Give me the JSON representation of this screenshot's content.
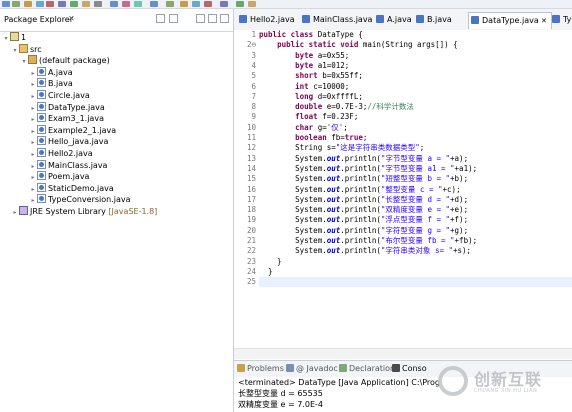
{
  "colors": {
    "keyword": "#7f0055",
    "string": "#2a00ff",
    "comment": "#3f7f5f",
    "field": "#0000c0",
    "line_number": "#787878",
    "jre_version": "#8a6a2a"
  },
  "explorer": {
    "title": "Package Explorer",
    "close": "✕",
    "tree": [
      {
        "label": "1",
        "indent": 0,
        "icon": "project-icon",
        "twisty": "▾"
      },
      {
        "label": "src",
        "indent": 1,
        "icon": "source-folder-icon",
        "twisty": "▾"
      },
      {
        "label": "(default package)",
        "indent": 2,
        "icon": "package-icon",
        "twisty": "▾"
      },
      {
        "label": "A.java",
        "indent": 3,
        "icon": "java-file-icon",
        "twisty": "▸"
      },
      {
        "label": "B.java",
        "indent": 3,
        "icon": "java-file-icon",
        "twisty": "▸"
      },
      {
        "label": "Circle.java",
        "indent": 3,
        "icon": "java-file-icon",
        "twisty": "▸"
      },
      {
        "label": "DataType.java",
        "indent": 3,
        "icon": "java-file-icon",
        "twisty": "▸"
      },
      {
        "label": "Exam3_1.java",
        "indent": 3,
        "icon": "java-file-icon",
        "twisty": "▸"
      },
      {
        "label": "Example2_1.java",
        "indent": 3,
        "icon": "java-file-icon",
        "twisty": "▸"
      },
      {
        "label": "Hello_java.java",
        "indent": 3,
        "icon": "java-file-icon",
        "twisty": "▸"
      },
      {
        "label": "Hello2.java",
        "indent": 3,
        "icon": "java-file-icon",
        "twisty": "▸"
      },
      {
        "label": "MainClass.java",
        "indent": 3,
        "icon": "java-file-icon",
        "twisty": "▸"
      },
      {
        "label": "Poem.java",
        "indent": 3,
        "icon": "java-file-icon",
        "twisty": "▸"
      },
      {
        "label": "StaticDemo.java",
        "indent": 3,
        "icon": "java-file-icon",
        "twisty": "▸"
      },
      {
        "label": "TypeConversion.java",
        "indent": 3,
        "icon": "java-file-icon",
        "twisty": "▸"
      },
      {
        "label": "JRE System Library",
        "indent": 1,
        "icon": "library-icon",
        "twisty": "▸",
        "suffix": "[JavaSE-1.8]"
      }
    ]
  },
  "editor_tabs": [
    {
      "label": "Hello2.java",
      "active": false
    },
    {
      "label": "MainClass.java",
      "active": false
    },
    {
      "label": "A.java",
      "active": false
    },
    {
      "label": "B.java",
      "active": false
    },
    {
      "label": "DataType.java",
      "active": true,
      "close": "✕"
    },
    {
      "label": "Ty",
      "active": false
    }
  ],
  "code_lines": [
    {
      "n": "1",
      "tokens": [
        [
          "kw",
          "public class "
        ],
        [
          "",
          "DataType {"
        ]
      ]
    },
    {
      "n": "2⊖",
      "tokens": [
        [
          "",
          "    "
        ],
        [
          "kw",
          "public static void "
        ],
        [
          "",
          "main(String args[]) {"
        ]
      ]
    },
    {
      "n": "3",
      "tokens": [
        [
          "",
          "        "
        ],
        [
          "kw",
          "byte "
        ],
        [
          "",
          "a=0x55;"
        ]
      ]
    },
    {
      "n": "4",
      "tokens": [
        [
          "",
          "        "
        ],
        [
          "kw",
          "byte "
        ],
        [
          "",
          "a1=012;"
        ]
      ]
    },
    {
      "n": "5",
      "tokens": [
        [
          "",
          "        "
        ],
        [
          "kw",
          "short "
        ],
        [
          "",
          "b=0x55ff;"
        ]
      ]
    },
    {
      "n": "6",
      "tokens": [
        [
          "",
          "        "
        ],
        [
          "kw",
          "int "
        ],
        [
          "",
          "c=10000;"
        ]
      ]
    },
    {
      "n": "7",
      "tokens": [
        [
          "",
          "        "
        ],
        [
          "kw",
          "long "
        ],
        [
          "",
          "d=0xffffL;"
        ]
      ]
    },
    {
      "n": "8",
      "tokens": [
        [
          "",
          "        "
        ],
        [
          "kw",
          "double "
        ],
        [
          "",
          "e=0.7E-3;"
        ],
        [
          "cmt",
          "//科学计数法"
        ]
      ]
    },
    {
      "n": "9",
      "tokens": [
        [
          "",
          "        "
        ],
        [
          "kw",
          "float "
        ],
        [
          "",
          "f=0.23F;"
        ]
      ]
    },
    {
      "n": "10",
      "tokens": [
        [
          "",
          "        "
        ],
        [
          "kw",
          "char "
        ],
        [
          "",
          "g="
        ],
        [
          "str",
          "'仅'"
        ],
        [
          ";",
          ";"
        ]
      ]
    },
    {
      "n": "11",
      "tokens": [
        [
          "",
          "        "
        ],
        [
          "kw",
          "boolean "
        ],
        [
          "",
          "fb="
        ],
        [
          "kw",
          "true"
        ],
        [
          "",
          ";"
        ]
      ]
    },
    {
      "n": "12",
      "tokens": [
        [
          "",
          "        String s="
        ],
        [
          "str",
          "\"这是字符串类数据类型\""
        ],
        [
          "",
          ";"
        ]
      ]
    },
    {
      "n": "13",
      "tokens": [
        [
          "",
          "        System."
        ],
        [
          "fld",
          "out"
        ],
        [
          "",
          ".println("
        ],
        [
          "str",
          "\"字节型变量 a = \""
        ],
        [
          "",
          "+a);"
        ]
      ]
    },
    {
      "n": "14",
      "tokens": [
        [
          "",
          "        System."
        ],
        [
          "fld",
          "out"
        ],
        [
          "",
          ".println("
        ],
        [
          "str",
          "\"字节型变量 a1 = \""
        ],
        [
          "",
          "+a1);"
        ]
      ]
    },
    {
      "n": "15",
      "tokens": [
        [
          "",
          "        System."
        ],
        [
          "fld",
          "out"
        ],
        [
          "",
          ".println("
        ],
        [
          "str",
          "\"短整型变量 b = \""
        ],
        [
          "",
          "+b);"
        ]
      ]
    },
    {
      "n": "16",
      "tokens": [
        [
          "",
          "        System."
        ],
        [
          "fld",
          "out"
        ],
        [
          "",
          ".println("
        ],
        [
          "str",
          "\"整型变量 c = \""
        ],
        [
          "",
          "+c);"
        ]
      ]
    },
    {
      "n": "17",
      "tokens": [
        [
          "",
          "        System."
        ],
        [
          "fld",
          "out"
        ],
        [
          "",
          ".println("
        ],
        [
          "str",
          "\"长整型变量 d = \""
        ],
        [
          "",
          "+d);"
        ]
      ]
    },
    {
      "n": "18",
      "tokens": [
        [
          "",
          "        System."
        ],
        [
          "fld",
          "out"
        ],
        [
          "",
          ".println("
        ],
        [
          "str",
          "\"双精度变量 e = \""
        ],
        [
          "",
          "+e);"
        ]
      ]
    },
    {
      "n": "19",
      "tokens": [
        [
          "",
          "        System."
        ],
        [
          "fld",
          "out"
        ],
        [
          "",
          ".println("
        ],
        [
          "str",
          "\"浮点型变量 f = \""
        ],
        [
          "",
          "+f);"
        ]
      ]
    },
    {
      "n": "20",
      "tokens": [
        [
          "",
          "        System."
        ],
        [
          "fld",
          "out"
        ],
        [
          "",
          ".println("
        ],
        [
          "str",
          "\"字符型变量 g = \""
        ],
        [
          "",
          "+g);"
        ]
      ]
    },
    {
      "n": "21",
      "tokens": [
        [
          "",
          "        System."
        ],
        [
          "fld",
          "out"
        ],
        [
          "",
          ".println("
        ],
        [
          "str",
          "\"布尔型变量 fb = \""
        ],
        [
          "",
          "+fb);"
        ]
      ]
    },
    {
      "n": "22",
      "tokens": [
        [
          "",
          "        System."
        ],
        [
          "fld",
          "out"
        ],
        [
          "",
          ".println("
        ],
        [
          "str",
          "\"字符串类对象 s= \""
        ],
        [
          "",
          "+s);"
        ]
      ]
    },
    {
      "n": "23",
      "tokens": [
        [
          "",
          "    }"
        ]
      ]
    },
    {
      "n": "24",
      "tokens": [
        [
          "",
          "  }"
        ]
      ]
    },
    {
      "n": "25",
      "tokens": [
        [
          "",
          ""
        ]
      ]
    }
  ],
  "bottom_tabs": [
    {
      "label": "Problems",
      "icon": "problems-icon"
    },
    {
      "label": "@ Javadoc",
      "icon": "javadoc-icon"
    },
    {
      "label": "Declaration",
      "icon": "declaration-icon"
    },
    {
      "label": "Conso",
      "icon": "console-icon"
    }
  ],
  "console": {
    "header": "<terminated> DataType [Java Application] C:\\Prog",
    "lines": [
      "长整型变量 d = 65535",
      "双精度变量 e = 7.0E-4"
    ]
  },
  "watermark": {
    "name": "创新互联",
    "subtitle": "CHUANG XIN HU LIAN"
  }
}
